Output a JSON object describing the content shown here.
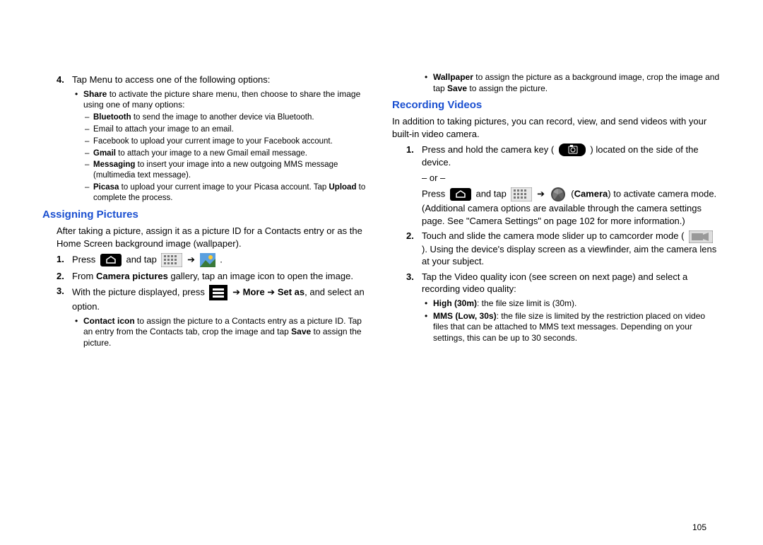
{
  "left": {
    "step4_num": "4.",
    "step4_text": "Tap Menu to access one of the following options:",
    "share_label": "Share",
    "share_text": " to activate the picture share menu, then choose to share the image using one of many options:",
    "bt_label": "Bluetooth",
    "bt_text": " to send the image to another device via Bluetooth.",
    "email_text": "Email to attach your image to an email.",
    "fb_text": "Facebook to upload your current image to your Facebook account.",
    "gmail_label": "Gmail",
    "gmail_text": " to attach your image to a new Gmail email message.",
    "msg_label": "Messaging",
    "msg_text": " to insert your image into a new outgoing MMS message (multimedia text message).",
    "picasa_label": "Picasa",
    "picasa_text": " to upload your current image to your Picasa account. Tap ",
    "picasa_upload": "Upload",
    "picasa_text2": " to complete the process.",
    "section_assign": "Assigning Pictures",
    "assign_intro": "After taking a picture, assign it as a picture ID for a Contacts entry or as the Home Screen background image (wallpaper).",
    "s1_num": "1.",
    "s1_press": "Press ",
    "s1_andtap": " and tap ",
    "s1_arrow": " ➔ ",
    "s1_dot": " .",
    "s2_num": "2.",
    "s2_a": "From ",
    "s2_b": "Camera pictures",
    "s2_c": " gallery, tap an image icon to open the image.",
    "s3_num": "3.",
    "s3_a": "With the picture displayed, press ",
    "s3_arrow": " ➔ ",
    "s3_more": "More",
    "s3_arrow2": " ➔ ",
    "s3_set": "Set as",
    "s3_c": ", and select an option.",
    "contact_label": "Contact icon",
    "contact_text": " to assign the picture to a Contacts entry as a picture ID. Tap an entry from the Contacts tab, crop the image and tap ",
    "contact_save": "Save",
    "contact_text2": " to assign the picture."
  },
  "right": {
    "wall_label": "Wallpaper",
    "wall_text": " to assign the picture as a background image, crop the image and tap ",
    "wall_save": "Save",
    "wall_text2": " to assign the picture.",
    "section_rec": "Recording Videos",
    "rec_intro": "In addition to taking pictures, you can record, view, and send videos with your built-in video camera.",
    "r1_num": "1.",
    "r1_a": "Press and hold the camera key ( ",
    "r1_b": " ) located on the side of the device.",
    "or": "– or –",
    "r1_press": "Press ",
    "r1_andtap": " and tap ",
    "r1_arrow": " ➔ ",
    "r1_camera": "Camera",
    "r1_c": ") to activate camera mode. (Additional camera options are available through the camera settings page. See \"Camera Settings\" on page 102 for more information.)",
    "r2_num": "2.",
    "r2_a": "Touch and slide the camera mode slider up to camcorder mode ( ",
    "r2_b": " ). Using the device's display screen as a viewfinder, aim the camera lens at your subject.",
    "r3_num": "3.",
    "r3_text": "Tap the Video quality icon (see screen on next page) and select a recording video quality:",
    "high_label": "High (30m)",
    "high_text": ": the file size limit is (30m).",
    "mms_label": "MMS (Low, 30s)",
    "mms_text": ": the file size is limited by the restriction placed on video files that can be attached to MMS text messages. Depending on your settings, this can be up to 30 seconds."
  },
  "pagenum": "105"
}
